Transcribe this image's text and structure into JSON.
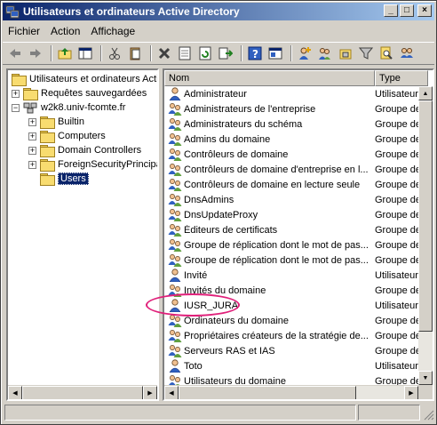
{
  "window": {
    "title": "Utilisateurs et ordinateurs Active Directory",
    "controls": {
      "minimize": "_",
      "maximize": "□",
      "close": "×"
    }
  },
  "menu": [
    {
      "label": "Fichier"
    },
    {
      "label": "Action"
    },
    {
      "label": "Affichage"
    }
  ],
  "toolbar": [
    "back-icon",
    "forward-icon",
    "up-folder-icon",
    "show-tree-icon",
    "cut-icon",
    "paste-icon",
    "delete-icon",
    "properties-icon",
    "refresh-icon",
    "export-icon",
    "help-icon",
    "console-icon",
    "new-user-icon",
    "new-group-icon",
    "new-ou-icon",
    "filter-icon",
    "find-icon",
    "add-to-group-icon"
  ],
  "tree": {
    "root": "Utilisateurs et ordinateurs Active Directory",
    "items": [
      {
        "label": "Requêtes sauvegardées",
        "expander": "+"
      },
      {
        "label": "w2k8.univ-fcomte.fr",
        "expander": "−"
      },
      {
        "label": "Builtin",
        "expander": "+"
      },
      {
        "label": "Computers",
        "expander": "+"
      },
      {
        "label": "Domain Controllers",
        "expander": "+"
      },
      {
        "label": "ForeignSecurityPrincipals",
        "expander": "+"
      },
      {
        "label": "Users",
        "expander": ""
      }
    ]
  },
  "list": {
    "columns": {
      "name": "Nom",
      "type": "Type"
    },
    "rows": [
      {
        "name": "Administrateur",
        "type": "Utilisateur",
        "kind": "user"
      },
      {
        "name": "Administrateurs de l'entreprise",
        "type": "Groupe de séc",
        "kind": "group"
      },
      {
        "name": "Administrateurs du schéma",
        "type": "Groupe de séc",
        "kind": "group"
      },
      {
        "name": "Admins du domaine",
        "type": "Groupe de séc",
        "kind": "group"
      },
      {
        "name": "Contrôleurs de domaine",
        "type": "Groupe de séc",
        "kind": "group"
      },
      {
        "name": "Contrôleurs de domaine d'entreprise en l...",
        "type": "Groupe de séc",
        "kind": "group"
      },
      {
        "name": "Contrôleurs de domaine en lecture seule",
        "type": "Groupe de séc",
        "kind": "group"
      },
      {
        "name": "DnsAdmins",
        "type": "Groupe de séc",
        "kind": "group"
      },
      {
        "name": "DnsUpdateProxy",
        "type": "Groupe de séc",
        "kind": "group"
      },
      {
        "name": "Éditeurs de certificats",
        "type": "Groupe de séc",
        "kind": "group"
      },
      {
        "name": "Groupe de réplication dont le mot de pas...",
        "type": "Groupe de séc",
        "kind": "group"
      },
      {
        "name": "Groupe de réplication dont le mot de pas...",
        "type": "Groupe de séc",
        "kind": "group"
      },
      {
        "name": "Invité",
        "type": "Utilisateur",
        "kind": "user"
      },
      {
        "name": "Invités du domaine",
        "type": "Groupe de séc",
        "kind": "group"
      },
      {
        "name": "IUSR_JURA",
        "type": "Utilisateur",
        "kind": "user"
      },
      {
        "name": "Ordinateurs du domaine",
        "type": "Groupe de séc",
        "kind": "group"
      },
      {
        "name": "Propriétaires créateurs de la stratégie de...",
        "type": "Groupe de séc",
        "kind": "group"
      },
      {
        "name": "Serveurs RAS et IAS",
        "type": "Groupe de séc",
        "kind": "group"
      },
      {
        "name": "Toto",
        "type": "Utilisateur",
        "kind": "user"
      },
      {
        "name": "Utilisateurs du domaine",
        "type": "Groupe de séc",
        "kind": "group"
      }
    ]
  },
  "colors": {
    "title_start": "#0a246a",
    "title_end": "#a6caf0",
    "highlight": "#e0207a",
    "selection": "#0a246a"
  }
}
